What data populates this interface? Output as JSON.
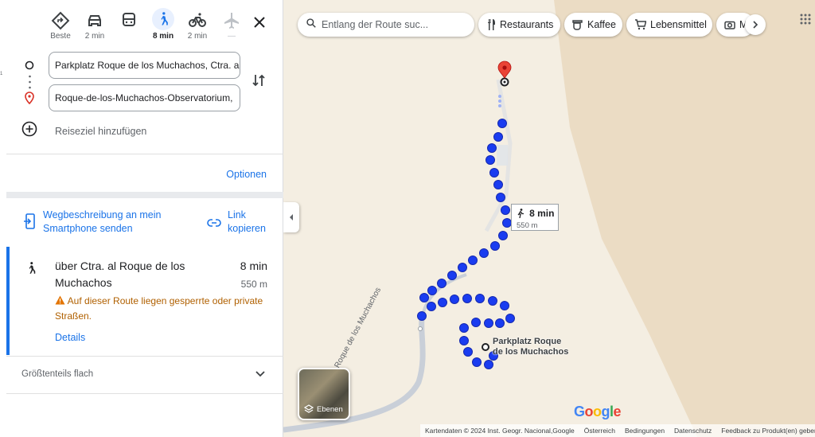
{
  "modes": [
    {
      "name": "beste",
      "label": "Beste"
    },
    {
      "name": "car",
      "label": "2 min"
    },
    {
      "name": "transit",
      "label": ""
    },
    {
      "name": "walk",
      "label": "8 min"
    },
    {
      "name": "bike",
      "label": "2 min"
    },
    {
      "name": "flight",
      "label": "—"
    }
  ],
  "route_inputs": {
    "origin": "Parkplatz Roque de los Muchachos, Ctra. a",
    "destination": "Roque-de-los-Muchachos-Observatorium, "
  },
  "add_destination": "Reiseziel hinzufügen",
  "options_label": "Optionen",
  "send_to_phone": "Wegbeschreibung an mein Smartphone senden",
  "copy_link": "Link kopieren",
  "route": {
    "title": "über Ctra. al Roque de los Muchachos",
    "duration": "8 min",
    "distance": "550 m",
    "warning": "Auf dieser Route liegen gesperrte oder private Straßen.",
    "details": "Details"
  },
  "terrain_note": "Größtenteils flach",
  "search": {
    "placeholder": "Entlang der Route suc..."
  },
  "chips": [
    {
      "icon": "restaurant-icon",
      "label": "Restaurants"
    },
    {
      "icon": "coffee-icon",
      "label": "Kaffee"
    },
    {
      "icon": "cart-icon",
      "label": "Lebensmittel"
    },
    {
      "icon": "camera-icon",
      "label": "Mu"
    }
  ],
  "map": {
    "time_label": "8 min",
    "distance_label": "550 m",
    "place_name_line1": "Parkplatz Roque",
    "place_name_line2": "de los Muchachos",
    "road_name": "Ctra. al Roque de los Muchachos",
    "layers_label": "Ebenen",
    "google_logo": "Google"
  },
  "footer": [
    "Kartendaten © 2024 Inst. Geogr. Nacional,Google",
    "Österreich",
    "Bedingungen",
    "Datenschutz",
    "Feedback zu Produkt(en) geben"
  ],
  "colors": {
    "accent": "#1a73e8",
    "route_dot": "#1a3cf0",
    "warning": "#b06000",
    "map_bg": "#f4eee2"
  }
}
